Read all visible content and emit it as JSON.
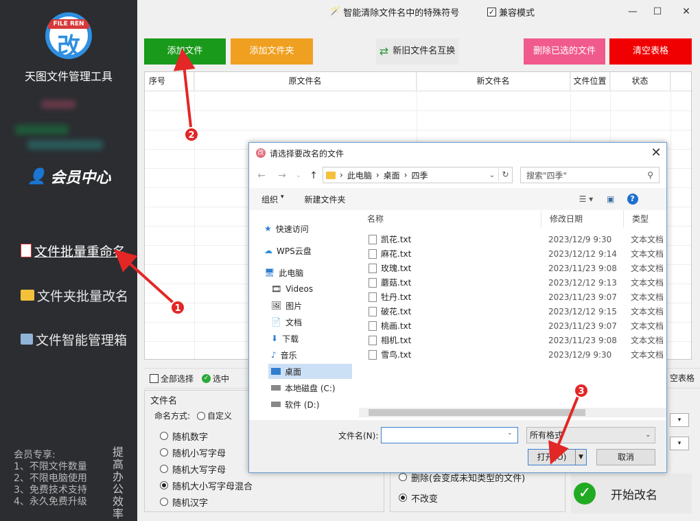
{
  "app": {
    "logo_text": "FILE REN",
    "logo_glyph": "改",
    "name": "天图文件管理工具",
    "member_center": "会员中心"
  },
  "sidebar": {
    "items": [
      {
        "label": "文件批量重命名",
        "icon": "document-icon"
      },
      {
        "label": "文件夹批量改名",
        "icon": "folder-icon"
      },
      {
        "label": "文件智能管理箱",
        "icon": "magnifier-icon"
      }
    ],
    "vip_lines": [
      "会员专享:",
      "1、不限文件数量",
      "2、不限电脑使用",
      "3、免费技术支持",
      "4、永久免费升级"
    ],
    "slogan": "提高办公效率"
  },
  "topbar": {
    "smart_clean": "智能清除文件名中的特殊符号",
    "compat_mode": "兼容模式",
    "compat_checked": true
  },
  "actions": {
    "add_file": "添加文件",
    "add_folder": "添加文件夹",
    "swap": "新旧文件名互换",
    "delete_selected": "删除已选的文件",
    "clear_table": "清空表格"
  },
  "table": {
    "columns": [
      "序号",
      "原文件名",
      "新文件名",
      "文件位置",
      "状态"
    ]
  },
  "bottom": {
    "select_all": "全部选择",
    "select": "选中",
    "clear_table_partial": "空表格",
    "filename_section": "文件名",
    "naming_mode_label": "命名方式:",
    "custom": "自定义",
    "options": [
      "随机数字",
      "随机小写字母",
      "随机大写字母",
      "随机大小写字母混合",
      "随机汉字"
    ],
    "selected_option": 3,
    "ext_options": [
      "删除(会变成未知类型的文件)",
      "不改变"
    ],
    "ext_selected": 1,
    "start": "开始改名"
  },
  "dialog": {
    "title": "请选择要改名的文件",
    "breadcrumb": [
      "此电脑",
      "桌面",
      "四季"
    ],
    "search_placeholder": "搜索\"四季\"",
    "organize": "组织",
    "new_folder": "新建文件夹",
    "nav": [
      {
        "label": "快速访问",
        "icon": "star-icon"
      },
      {
        "label": "WPS云盘",
        "icon": "cloud-icon"
      },
      {
        "label": "此电脑",
        "icon": "computer-icon"
      },
      {
        "label": "Videos",
        "icon": "video-icon"
      },
      {
        "label": "图片",
        "icon": "picture-icon"
      },
      {
        "label": "文档",
        "icon": "document-icon"
      },
      {
        "label": "下载",
        "icon": "download-icon"
      },
      {
        "label": "音乐",
        "icon": "music-icon"
      },
      {
        "label": "桌面",
        "icon": "desktop-icon"
      },
      {
        "label": "本地磁盘 (C:)",
        "icon": "drive-icon"
      },
      {
        "label": "软件 (D:)",
        "icon": "drive-icon"
      }
    ],
    "nav_selected": 8,
    "list_columns": [
      "名称",
      "修改日期",
      "类型"
    ],
    "files": [
      {
        "name": "凯花.txt",
        "date": "2023/12/9 9:30",
        "type": "文本文档"
      },
      {
        "name": "麻花.txt",
        "date": "2023/12/12 9:14",
        "type": "文本文档"
      },
      {
        "name": "玫瑰.txt",
        "date": "2023/11/23 9:08",
        "type": "文本文档"
      },
      {
        "name": "蘑菇.txt",
        "date": "2023/12/12 9:13",
        "type": "文本文档"
      },
      {
        "name": "牡丹.txt",
        "date": "2023/11/23 9:07",
        "type": "文本文档"
      },
      {
        "name": "破花.txt",
        "date": "2023/12/12 9:15",
        "type": "文本文档"
      },
      {
        "name": "桃画.txt",
        "date": "2023/11/23 9:07",
        "type": "文本文档"
      },
      {
        "name": "相机.txt",
        "date": "2023/11/23 9:08",
        "type": "文本文档"
      },
      {
        "name": "雪鸟.txt",
        "date": "2023/12/9 9:30",
        "type": "文本文档"
      }
    ],
    "filename_label": "文件名(N):",
    "filename_value": "",
    "filter": "所有格式",
    "open": "打开(O)",
    "cancel": "取消"
  },
  "annotations": [
    "1",
    "2",
    "3"
  ],
  "colors": {
    "sidebar_bg": "#2b2d31",
    "add_file": "#1a9a1a",
    "add_folder": "#f0a020",
    "delete_selected": "#f05a8c",
    "clear_table": "#f00000",
    "annotation": "#e32626"
  }
}
